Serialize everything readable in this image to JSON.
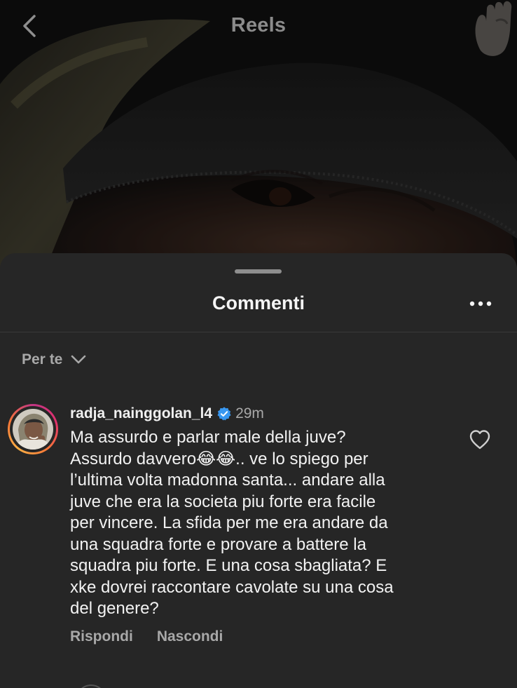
{
  "header": {
    "title": "Reels",
    "back_icon": "chevron-left-icon",
    "sticker_icon": "sticker-icon"
  },
  "sheet": {
    "title": "Commenti",
    "more_icon": "more-horizontal-icon",
    "sort_label": "Per te",
    "sort_icon": "chevron-down-icon"
  },
  "comment": {
    "username": "radja_nainggolan_l4",
    "verified": true,
    "time": "29m",
    "text": "Ma assurdo e parlar male della juve?\nAssurdo davvero😂😂.. ve lo spiego per\nl’ultima volta madonna santa... andare alla\njuve che era la societa piu forte era facile\nper vincere. La sfida per me era andare da\nuna squadra forte e provare a battere la\nsquadra piu forte. E una cosa sbagliata? E\nxke dovrei raccontare cavolate su una cosa\ndel genere?",
    "reply_label": "Rispondi",
    "hide_label": "Nascondi",
    "like_icon": "heart-outline-icon"
  },
  "colors": {
    "sheet_background": "#262626",
    "verified_badge": "#3897f0",
    "secondary_text": "#a8a8a8"
  }
}
